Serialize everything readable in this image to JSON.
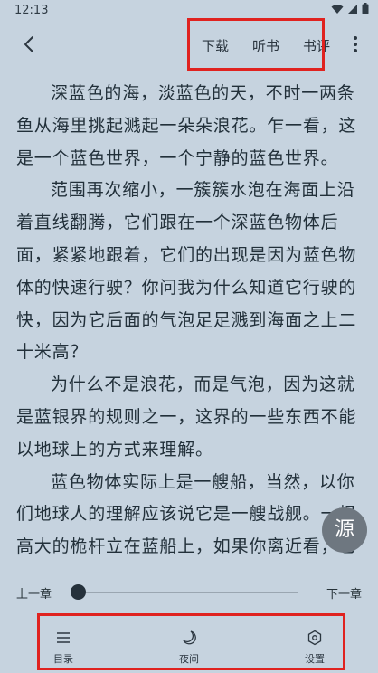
{
  "status_bar": {
    "time": "12:13"
  },
  "top_bar": {
    "actions": [
      "下载",
      "听书",
      "书评"
    ]
  },
  "content": {
    "paragraphs": [
      "深蓝色的海，淡蓝色的天，不时一两条鱼从海里挑起溅起一朵朵浪花。乍一看，这是一个蓝色世界，一个宁静的蓝色世界。",
      "范围再次缩小，一簇簇水泡在海面上沿着直线翻腾，它们跟在一个深蓝色物体后面，紧紧地跟着，它们的出现是因为蓝色物体的快速行驶？你问我为什么知道它行驶的快，因为它后面的气泡足足溅到海面之上二十米高？",
      "为什么不是浪花，而是气泡，因为这就是蓝银界的规则之一，这界的一些东西不能以地球上的方式来理解。",
      "蓝色物体实际上是一艘船，当然，以你们地球人的理解应该说它是一艘战舰。一根高大的桅杆立在蓝船上，如果你离近看，它从底到上的空"
    ]
  },
  "source_button": {
    "label": "源"
  },
  "chapter_nav": {
    "prev_label": "上一章",
    "next_label": "下一章",
    "progress": 0
  },
  "bottom_bar": {
    "tabs": [
      {
        "label": "目录",
        "icon": "menu-icon"
      },
      {
        "label": "夜间",
        "icon": "moon-icon"
      },
      {
        "label": "设置",
        "icon": "settings-icon"
      }
    ]
  }
}
